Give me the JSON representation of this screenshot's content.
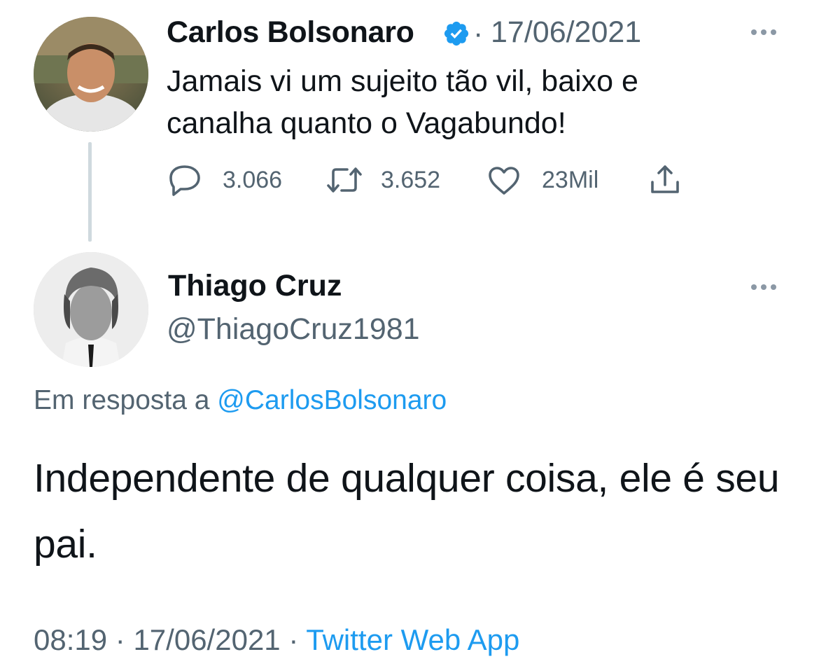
{
  "tweet": {
    "author_name": "Carlos Bolsonaro",
    "separator": "·",
    "date": "17/06/2021",
    "text": "Jamais vi um sujeito tão vil, baixo e canalha quanto o Vagabundo!",
    "actions": {
      "reply_count": "3.066",
      "retweet_count": "3.652",
      "like_count": "23Mil"
    },
    "icons": [
      "avatar",
      "verified-badge-icon",
      "more-icon",
      "reply-icon",
      "retweet-icon",
      "like-icon",
      "share-icon"
    ]
  },
  "reply": {
    "author_name": "Thiago Cruz",
    "handle": "@ThiagoCruz1981",
    "in_reply_prefix": "Em resposta a",
    "in_reply_mention": "@CarlosBolsonaro",
    "text": "Independente de qualquer coisa, ele é seu pai.",
    "time": "08:19",
    "separator": "·",
    "date": "17/06/2021",
    "separator2": "·",
    "source": "Twitter Web App"
  },
  "colors": {
    "text": "#0f1419",
    "secondary": "#536471",
    "link": "#1d9bf0",
    "thread_line": "#cfd9de"
  }
}
